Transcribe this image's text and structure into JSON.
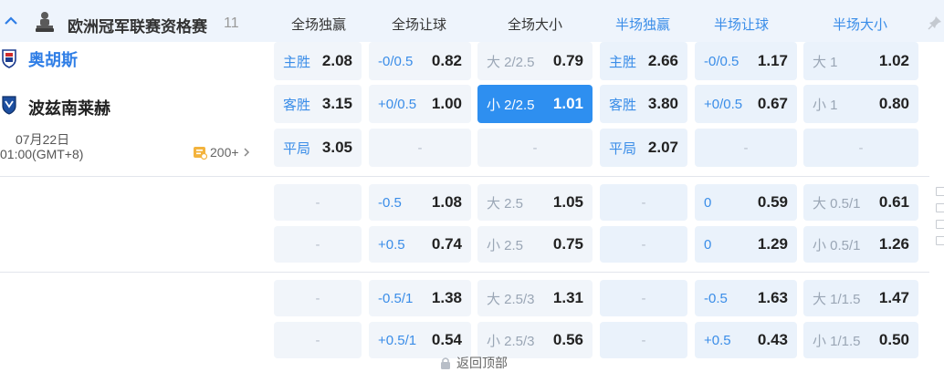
{
  "league": {
    "name": "欧洲冠军联赛资格赛",
    "count": "11"
  },
  "columns": [
    "全场独赢",
    "全场让球",
    "全场大小",
    "半场独赢",
    "半场让球",
    "半场大小"
  ],
  "match": {
    "home": "奥胡斯",
    "away": "波兹南莱赫",
    "date": "07月22日",
    "time": "01:00(GMT+8)",
    "more": "200+"
  },
  "rows": [
    [
      {
        "label": "主胜",
        "value": "2.08"
      },
      {
        "label": "-0/0.5",
        "value": "0.82"
      },
      {
        "label": "大 2/2.5",
        "value": "0.79",
        "grey": true
      },
      {
        "label": "主胜",
        "value": "2.66"
      },
      {
        "label": "-0/0.5",
        "value": "1.17"
      },
      {
        "label": "大 1",
        "value": "1.02",
        "grey": true
      }
    ],
    [
      {
        "label": "客胜",
        "value": "3.15"
      },
      {
        "label": "+0/0.5",
        "value": "1.00"
      },
      {
        "label": "小 2/2.5",
        "value": "1.01",
        "selected": true
      },
      {
        "label": "客胜",
        "value": "3.80"
      },
      {
        "label": "+0/0.5",
        "value": "0.67"
      },
      {
        "label": "小 1",
        "value": "0.80",
        "grey": true
      }
    ],
    [
      {
        "label": "平局",
        "value": "3.05"
      },
      {
        "empty": true,
        "text": "-"
      },
      {
        "empty": true,
        "text": "-"
      },
      {
        "label": "平局",
        "value": "2.07"
      },
      {
        "empty": true,
        "text": "-"
      },
      {
        "empty": true,
        "text": "-"
      }
    ],
    [
      {
        "empty": true,
        "text": "-"
      },
      {
        "label": "-0.5",
        "value": "1.08"
      },
      {
        "label": "大 2.5",
        "value": "1.05",
        "grey": true
      },
      {
        "empty": true,
        "text": "-"
      },
      {
        "label": "0",
        "value": "0.59"
      },
      {
        "label": "大 0.5/1",
        "value": "0.61",
        "grey": true
      }
    ],
    [
      {
        "empty": true,
        "text": "-"
      },
      {
        "label": "+0.5",
        "value": "0.74"
      },
      {
        "label": "小 2.5",
        "value": "0.75",
        "grey": true
      },
      {
        "empty": true,
        "text": "-"
      },
      {
        "label": "0",
        "value": "1.29"
      },
      {
        "label": "小 0.5/1",
        "value": "1.26",
        "grey": true
      }
    ],
    [
      {
        "empty": true,
        "text": "-"
      },
      {
        "label": "-0.5/1",
        "value": "1.38"
      },
      {
        "label": "大 2.5/3",
        "value": "1.31",
        "grey": true
      },
      {
        "empty": true,
        "text": "-"
      },
      {
        "label": "-0.5",
        "value": "1.63"
      },
      {
        "label": "大 1/1.5",
        "value": "1.47",
        "grey": true
      }
    ],
    [
      {
        "empty": true,
        "text": "-"
      },
      {
        "label": "+0.5/1",
        "value": "0.54"
      },
      {
        "label": "小 2.5/3",
        "value": "0.56",
        "grey": true
      },
      {
        "empty": true,
        "text": "-"
      },
      {
        "label": "+0.5",
        "value": "0.43"
      },
      {
        "label": "小 1/1.5",
        "value": "0.50",
        "grey": true
      }
    ]
  ],
  "back_to_top": "返回顶部",
  "colors": {
    "accent": "#2e8ff0",
    "half_header": "#3a8de8",
    "cell_bg": "#f1f5fa"
  },
  "icons": [
    "chevron-up-icon",
    "trophy-icon",
    "team-crest-icon",
    "pin-icon",
    "chevron-right-icon",
    "market-icon",
    "lock-icon"
  ]
}
